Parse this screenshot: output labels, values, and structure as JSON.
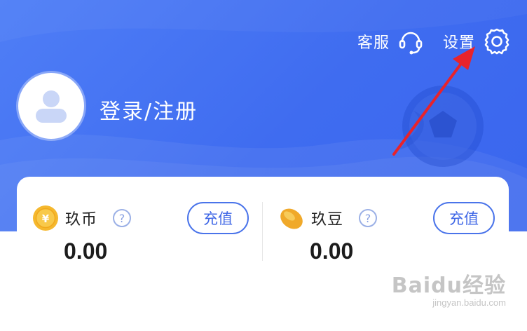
{
  "header": {
    "customer_service_label": "客服",
    "settings_label": "设置",
    "login_label": "登录/注册",
    "background_color": "#4574f2"
  },
  "balances": [
    {
      "name": "玖币",
      "value": "0.00",
      "button_label": "充值",
      "icon": "gold-coin-icon"
    },
    {
      "name": "玖豆",
      "value": "0.00",
      "button_label": "充值",
      "icon": "bean-icon"
    }
  ],
  "help_symbol": "?",
  "watermark": {
    "text": "Baidu经验",
    "url_text": "jingyan.baidu.com"
  },
  "colors": {
    "accent": "#4a74ea",
    "annotation_arrow": "#e8232b",
    "coin": "#f5b82e"
  }
}
